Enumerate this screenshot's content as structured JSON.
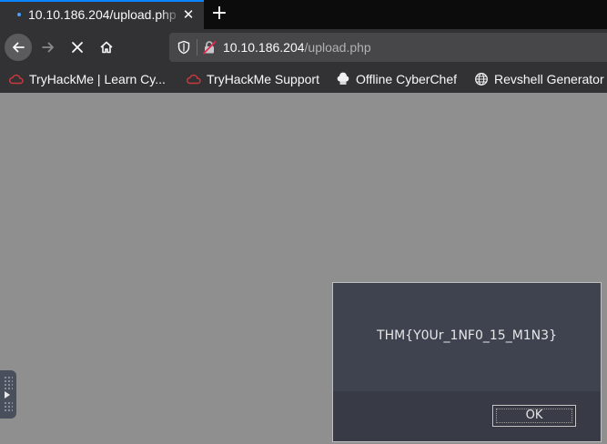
{
  "tab": {
    "title": "10.10.186.204/upload.php"
  },
  "url": {
    "host": "10.10.186.204",
    "path": "/upload.php"
  },
  "bookmarks": [
    {
      "label": "TryHackMe | Learn Cy...",
      "icon": "tryhackme-icon"
    },
    {
      "label": "TryHackMe Support",
      "icon": "tryhackme-icon"
    },
    {
      "label": "Offline CyberChef",
      "icon": "chef-hat-icon"
    },
    {
      "label": "Revshell Generator",
      "icon": "globe-icon"
    }
  ],
  "dialog": {
    "message": "THM{Y0Ur_1NF0_15_M1N3}",
    "ok_label": "OK"
  },
  "colors": {
    "accent": "#0a84ff",
    "tryhackme_red": "#c8393d"
  }
}
